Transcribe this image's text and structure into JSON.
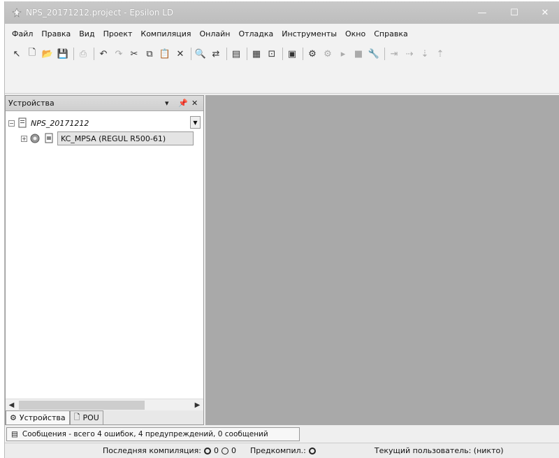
{
  "window": {
    "title": "NPS_20171212.project - Epsilon LD",
    "controls": {
      "minimize": "—",
      "maximize": "☐",
      "close": "✕"
    }
  },
  "menu": [
    "Файл",
    "Правка",
    "Вид",
    "Проект",
    "Компиляция",
    "Онлайн",
    "Отладка",
    "Инструменты",
    "Окно",
    "Справка"
  ],
  "toolbar": {
    "icons": [
      "pointer-icon",
      "new-file-icon",
      "open-folder-icon",
      "save-icon",
      "print-icon",
      "undo-icon",
      "redo-icon",
      "cut-icon",
      "copy-icon",
      "paste-icon",
      "delete-icon",
      "find-icon",
      "replace-icon",
      "device-icon",
      "insert-icon",
      "new-object-icon",
      "build-icon",
      "login-icon",
      "logout-icon",
      "run-icon",
      "stop-icon",
      "tools-icon",
      "breakpoint-icon"
    ]
  },
  "devices_panel": {
    "title": "Устройства",
    "tree": {
      "root": "NPS_20171212",
      "child": "KC_MPSA (REGUL R500-61)"
    },
    "tabs": [
      "Устройства",
      "POU"
    ]
  },
  "messages": {
    "tab": "Сообщения - всего 4 ошибок, 4 предупреждений, 0 сообщений"
  },
  "status": {
    "last_compile_label": "Последняя компиляция:",
    "errors": "0",
    "warnings": "0",
    "precompile_label": "Предкомпил.:",
    "user": "Текущий пользователь: (никто)"
  }
}
